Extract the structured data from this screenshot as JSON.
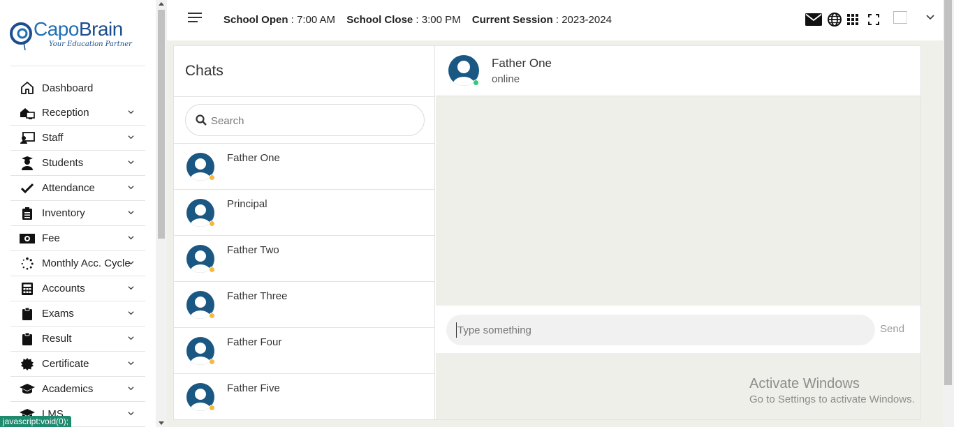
{
  "brand": {
    "name_part1": "Capo",
    "name_part2": "Brain",
    "tagline": "Your Education Partner",
    "color": "#1f6fb5"
  },
  "sidebar": {
    "items": [
      {
        "label": "Dashboard",
        "icon": "home-icon",
        "has_children": false
      },
      {
        "label": "Reception",
        "icon": "reception-icon",
        "has_children": true
      },
      {
        "label": "Staff",
        "icon": "staff-icon",
        "has_children": true
      },
      {
        "label": "Students",
        "icon": "student-icon",
        "has_children": true
      },
      {
        "label": "Attendance",
        "icon": "check-icon",
        "has_children": true
      },
      {
        "label": "Inventory",
        "icon": "clipboard-list-icon",
        "has_children": true
      },
      {
        "label": "Fee",
        "icon": "money-icon",
        "has_children": true
      },
      {
        "label": "Monthly Acc. Cycle",
        "icon": "spinner-icon",
        "has_children": true
      },
      {
        "label": "Accounts",
        "icon": "calculator-icon",
        "has_children": true
      },
      {
        "label": "Exams",
        "icon": "clipboard-icon",
        "has_children": true
      },
      {
        "label": "Result",
        "icon": "clipboard-icon",
        "has_children": true
      },
      {
        "label": "Certificate",
        "icon": "certificate-icon",
        "has_children": true
      },
      {
        "label": "Academics",
        "icon": "graduation-cap-icon",
        "has_children": true
      },
      {
        "label": "LMS",
        "icon": "graduation-cap-icon",
        "has_children": true
      }
    ]
  },
  "topbar": {
    "school_open_label": "School Open",
    "school_open_value": " : 7:00 AM",
    "school_close_label": "School Close",
    "school_close_value": " : 3:00 PM",
    "session_label": "Current Session",
    "session_value": " : 2023-2024",
    "icons": [
      "envelope-icon",
      "globe-icon",
      "apps-grid-icon",
      "fullscreen-icon"
    ]
  },
  "chat": {
    "title": "Chats",
    "search_placeholder": "Search",
    "contacts": [
      {
        "name": "Father One",
        "status": "away"
      },
      {
        "name": "Principal",
        "status": "away"
      },
      {
        "name": "Father Two",
        "status": "away"
      },
      {
        "name": "Father Three",
        "status": "away"
      },
      {
        "name": "Father Four",
        "status": "away"
      },
      {
        "name": "Father Five",
        "status": "away"
      }
    ],
    "active": {
      "name": "Father One",
      "status": "online"
    },
    "composer_placeholder": "Type something",
    "send_label": "Send",
    "colors": {
      "avatar": "#1a5783",
      "online": "#2ecc71",
      "away": "#f6b93b"
    }
  },
  "watermark": {
    "line1": "Activate Windows",
    "line2": "Go to Settings to activate Windows."
  },
  "statusbar": {
    "text": "javascript:void(0);"
  }
}
